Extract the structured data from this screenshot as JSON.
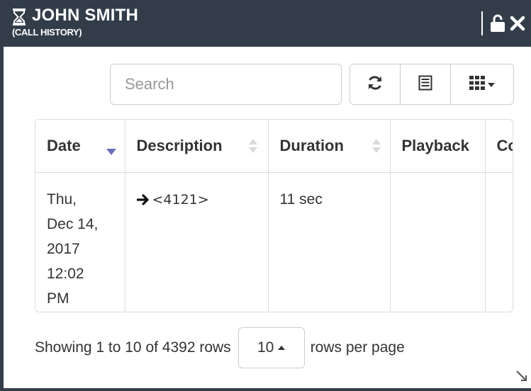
{
  "window": {
    "title": "JOHN SMITH",
    "subtitle": "(CALL HISTORY)",
    "icon": "hourglass-icon",
    "controls": [
      "unlock-icon",
      "close-icon"
    ]
  },
  "toolbar": {
    "search_placeholder": "Search",
    "search_value": "",
    "buttons": [
      "refresh-icon",
      "list-icon",
      "columns-icon"
    ]
  },
  "table": {
    "columns": [
      {
        "label": "Date",
        "sort": "descending"
      },
      {
        "label": "Description",
        "sort": "sortable"
      },
      {
        "label": "Duration",
        "sort": "sortable"
      },
      {
        "label": "Playback",
        "sort": "none"
      },
      {
        "label": "Co",
        "sort": "none"
      }
    ],
    "rows": [
      {
        "date_lines": [
          "Thu,",
          "Dec 14,",
          "2017",
          "12:02",
          "PM"
        ],
        "direction_icon": "arrow-right-icon",
        "description": "<4121>",
        "duration": "11 sec",
        "playback": "",
        "extra": ""
      }
    ]
  },
  "pagination": {
    "showing_text": "Showing 1 to 10 of 4392 rows",
    "page_size": "10",
    "rows_per_page_text": "rows per page"
  },
  "colors": {
    "titlebar": "#333d4a",
    "sort_active": "#6b6fb8",
    "border": "#dddddd"
  }
}
